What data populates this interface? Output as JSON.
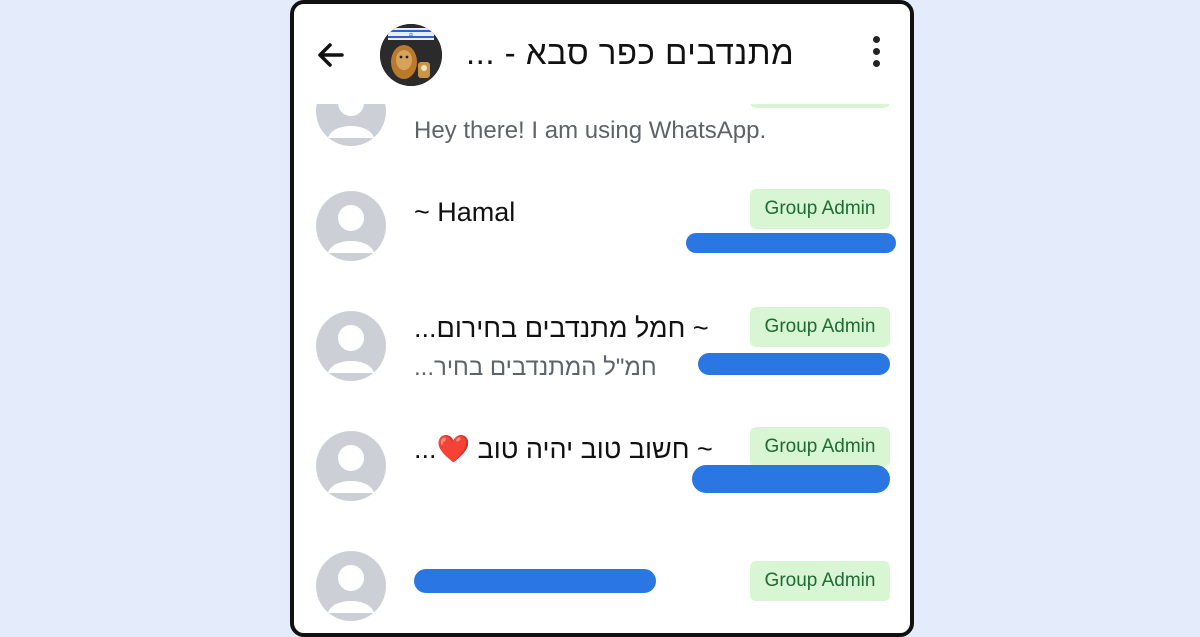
{
  "header": {
    "title": "מתנדבים כפר סבא - ...",
    "back_icon": "arrow-left-icon",
    "menu_icon": "kebab-menu-icon"
  },
  "participants": [
    {
      "name": "",
      "status": "Hey there! I am using WhatsApp.",
      "badge": ""
    },
    {
      "name": "~ Hamal",
      "status": "",
      "badge": "Group Admin"
    },
    {
      "name": "~ חמל מתנדבים בחירום...",
      "status": "חמ\"ל המתנדבים בחיר...",
      "badge": "Group Admin"
    },
    {
      "name": "~ חשוב טוב יהיה טוב ❤️...",
      "status": "",
      "badge": "Group Admin"
    },
    {
      "name": "",
      "status": "",
      "badge": "Group Admin"
    }
  ],
  "colors": {
    "background": "#e4ebfa",
    "badge_bg": "#d8f6d4",
    "badge_text": "#1e6b34",
    "redaction": "#1f6fe0"
  }
}
